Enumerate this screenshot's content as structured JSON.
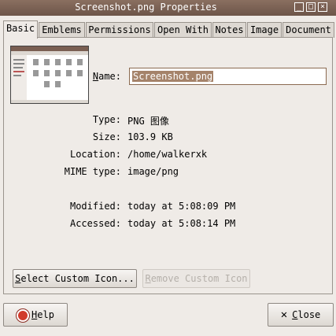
{
  "window": {
    "title": "Screenshot.png Properties",
    "buttons": {
      "minimize": "_",
      "maximize": "□",
      "close": "×"
    }
  },
  "tabs": [
    "Basic",
    "Emblems",
    "Permissions",
    "Open With",
    "Notes",
    "Image",
    "Document"
  ],
  "basic": {
    "name_label": "Name:",
    "name_mnemonic": "N",
    "name_rest": "ame:",
    "name_value": "Screenshot.png",
    "fields": [
      {
        "label": "Type:",
        "value": "PNG 图像"
      },
      {
        "label": "Size:",
        "value": "103.9 KB"
      },
      {
        "label": "Location:",
        "value": "/home/walkerxk"
      },
      {
        "label": "MIME type:",
        "value": "image/png"
      },
      {
        "label": "Modified:",
        "value": "today at 5:08:09 PM"
      },
      {
        "label": "Accessed:",
        "value": "today at 5:08:14 PM"
      }
    ],
    "select_icon_mnemonic": "S",
    "select_icon_rest": "elect Custom Icon...",
    "remove_icon_mnemonic": "R",
    "remove_icon_rest": "emove Custom Icon"
  },
  "footer": {
    "help_mnemonic": "H",
    "help_rest": "elp",
    "close_mnemonic": "C",
    "close_rest": "lose"
  },
  "colors": {
    "titlebar": "#7a5f52",
    "selection": "#a5836a",
    "background": "#efebe7"
  }
}
